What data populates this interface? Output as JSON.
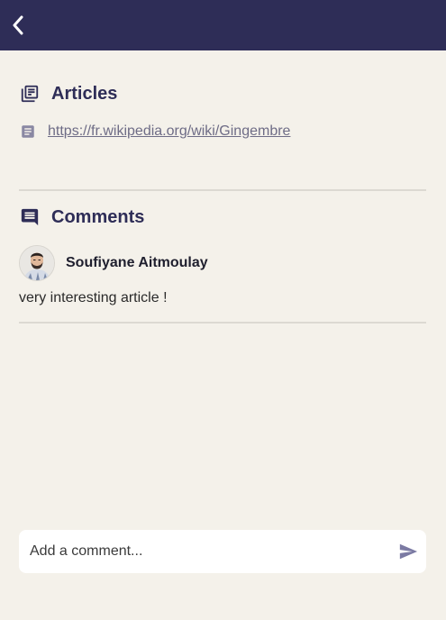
{
  "header": {
    "back_icon": "chevron-left-icon",
    "background_color": "#2e2d57"
  },
  "articles": {
    "title": "Articles",
    "icon": "library-books-icon",
    "items": [
      {
        "icon": "article-icon",
        "url": "https://fr.wikipedia.org/wiki/Gingembre"
      }
    ]
  },
  "comments": {
    "title": "Comments",
    "icon": "comment-icon",
    "items": [
      {
        "author": "Soufiyane Aitmoulay",
        "text": "very interesting article !"
      }
    ]
  },
  "composer": {
    "placeholder": "Add a comment...",
    "value": "",
    "send_icon": "send-icon"
  },
  "colors": {
    "primary": "#2e2d57",
    "background": "#f4f1ea",
    "link": "#6e6c86",
    "send": "#7b7aa3"
  }
}
